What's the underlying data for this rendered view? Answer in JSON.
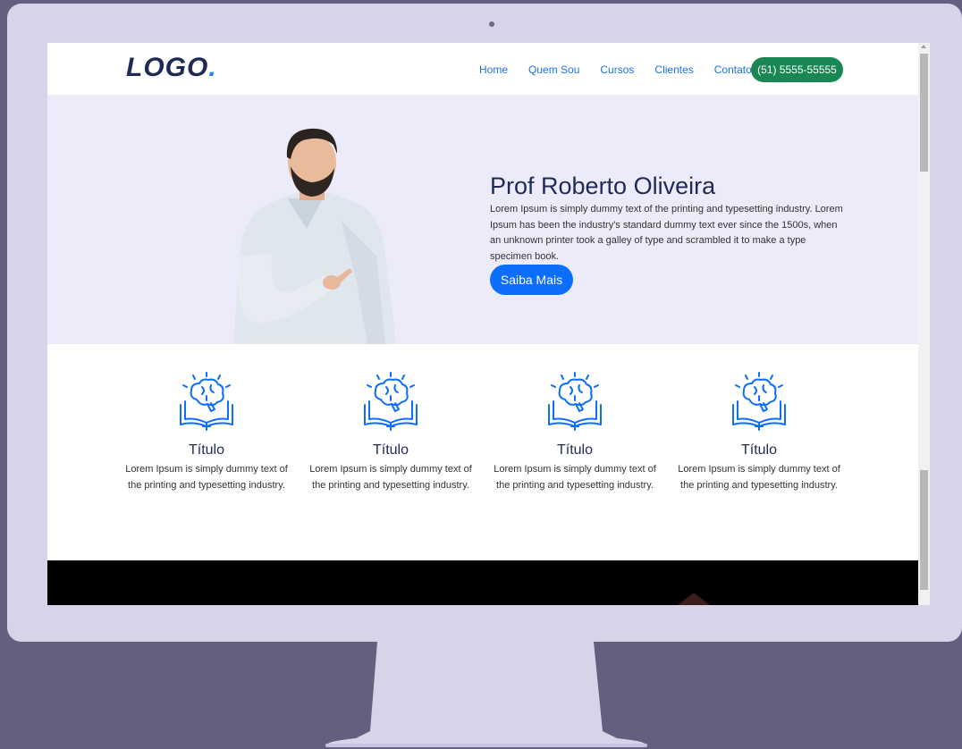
{
  "navbar": {
    "logo_text": "LOGO",
    "logo_dot": ".",
    "items": [
      "Home",
      "Quem Sou",
      "Cursos",
      "Clientes",
      "Contato"
    ],
    "phone": "(51) 5555-55555"
  },
  "hero": {
    "title": "Prof Roberto Oliveira",
    "text": "Lorem Ipsum is simply dummy text of the printing and typesetting industry. Lorem Ipsum has been the industry's standard dummy text ever since the 1500s, when an unknown printer took a galley of type and scrambled it to make a type specimen book.",
    "button": "Saiba Mais"
  },
  "features": [
    {
      "title": "Título",
      "text": "Lorem Ipsum is simply dummy text of the printing and typesetting industry."
    },
    {
      "title": "Título",
      "text": "Lorem Ipsum is simply dummy text of the printing and typesetting industry."
    },
    {
      "title": "Título",
      "text": "Lorem Ipsum is simply dummy text of the printing and typesetting industry."
    },
    {
      "title": "Título",
      "text": "Lorem Ipsum is simply dummy text of the printing and typesetting industry."
    }
  ],
  "icons": {
    "feature_icon": "brain-book-icon",
    "hero_image": "person-photo"
  },
  "colors": {
    "brand": "#1f2a55",
    "accent": "#0d6efd",
    "phone_button": "#198754",
    "hero_bg": "#ebebfa",
    "monitor": "#d7d4e9",
    "background": "#655f7f"
  }
}
